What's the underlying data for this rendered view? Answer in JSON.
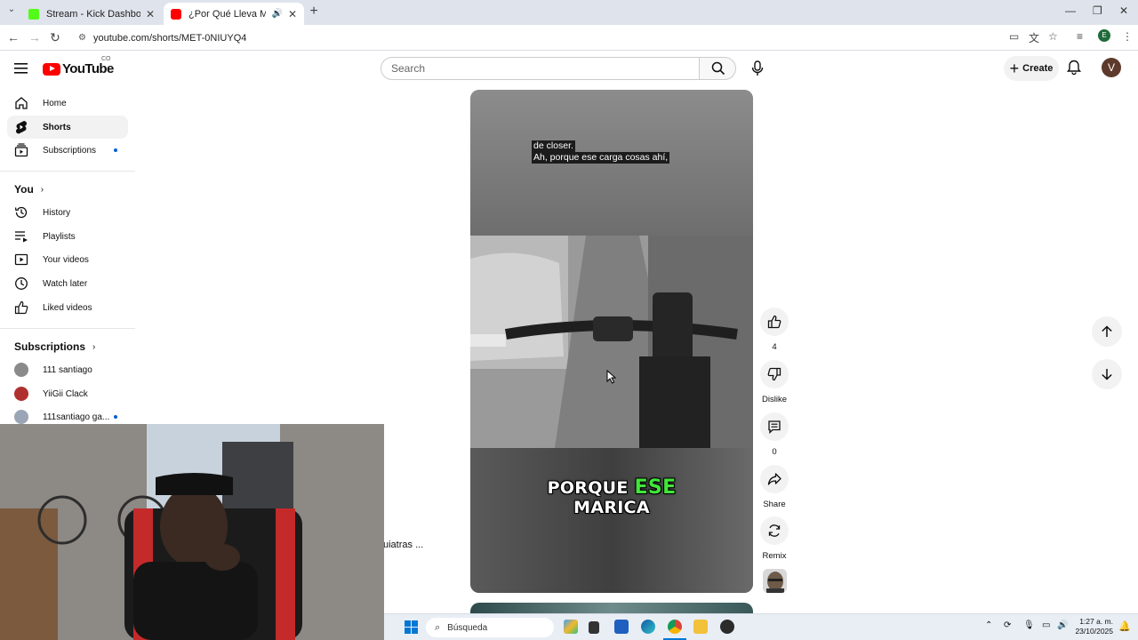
{
  "browser": {
    "tabs": [
      {
        "title": "Stream - Kick Dashboard",
        "favicon_color": "#53fc18",
        "active": false
      },
      {
        "title": "¿Por Qué Lleva Mochila? Re",
        "favicon_color": "#ff0000",
        "active": true
      }
    ],
    "url": "youtube.com/shorts/MET-0NIUYQ4",
    "new_tab_symbol": "+"
  },
  "header": {
    "logo_text": "YouTube",
    "country_code": "CO",
    "search_placeholder": "Search",
    "create_label": "Create",
    "avatar_letter": "V"
  },
  "sidebar": {
    "main": [
      {
        "label": "Home",
        "icon": "home-icon"
      },
      {
        "label": "Shorts",
        "icon": "shorts-icon",
        "active": true
      },
      {
        "label": "Subscriptions",
        "icon": "subscriptions-icon",
        "new_dot": true
      }
    ],
    "you_heading": "You",
    "you_items": [
      {
        "label": "History",
        "icon": "history-icon"
      },
      {
        "label": "Playlists",
        "icon": "playlists-icon"
      },
      {
        "label": "Your videos",
        "icon": "your-videos-icon"
      },
      {
        "label": "Watch later",
        "icon": "watch-later-icon"
      },
      {
        "label": "Liked videos",
        "icon": "liked-videos-icon"
      }
    ],
    "subs_heading": "Subscriptions",
    "channels": [
      {
        "label": "111 santiago",
        "color": "#8a8a8a"
      },
      {
        "label": "YiiGii Clack",
        "color": "#b03030"
      },
      {
        "label": "111santiago ga...",
        "color": "#9aa5b5",
        "new_dot": true
      }
    ]
  },
  "behind_overlay_text": "uiatras ...",
  "short": {
    "caption_line1": "de closer.",
    "caption_line2": "Ah, porque ese carga cosas ahí,",
    "big_caption_word1": "PORQUE",
    "big_caption_word2": "ESE",
    "big_caption_word3": "MARICA",
    "highlight_color": "#41e63a"
  },
  "actions": {
    "like_count": "4",
    "dislike_label": "Dislike",
    "comment_count": "0",
    "share_label": "Share",
    "remix_label": "Remix"
  },
  "taskbar": {
    "search_placeholder": "Búsqueda",
    "time": "1:27 a. m.",
    "date": "23/10/2025"
  }
}
